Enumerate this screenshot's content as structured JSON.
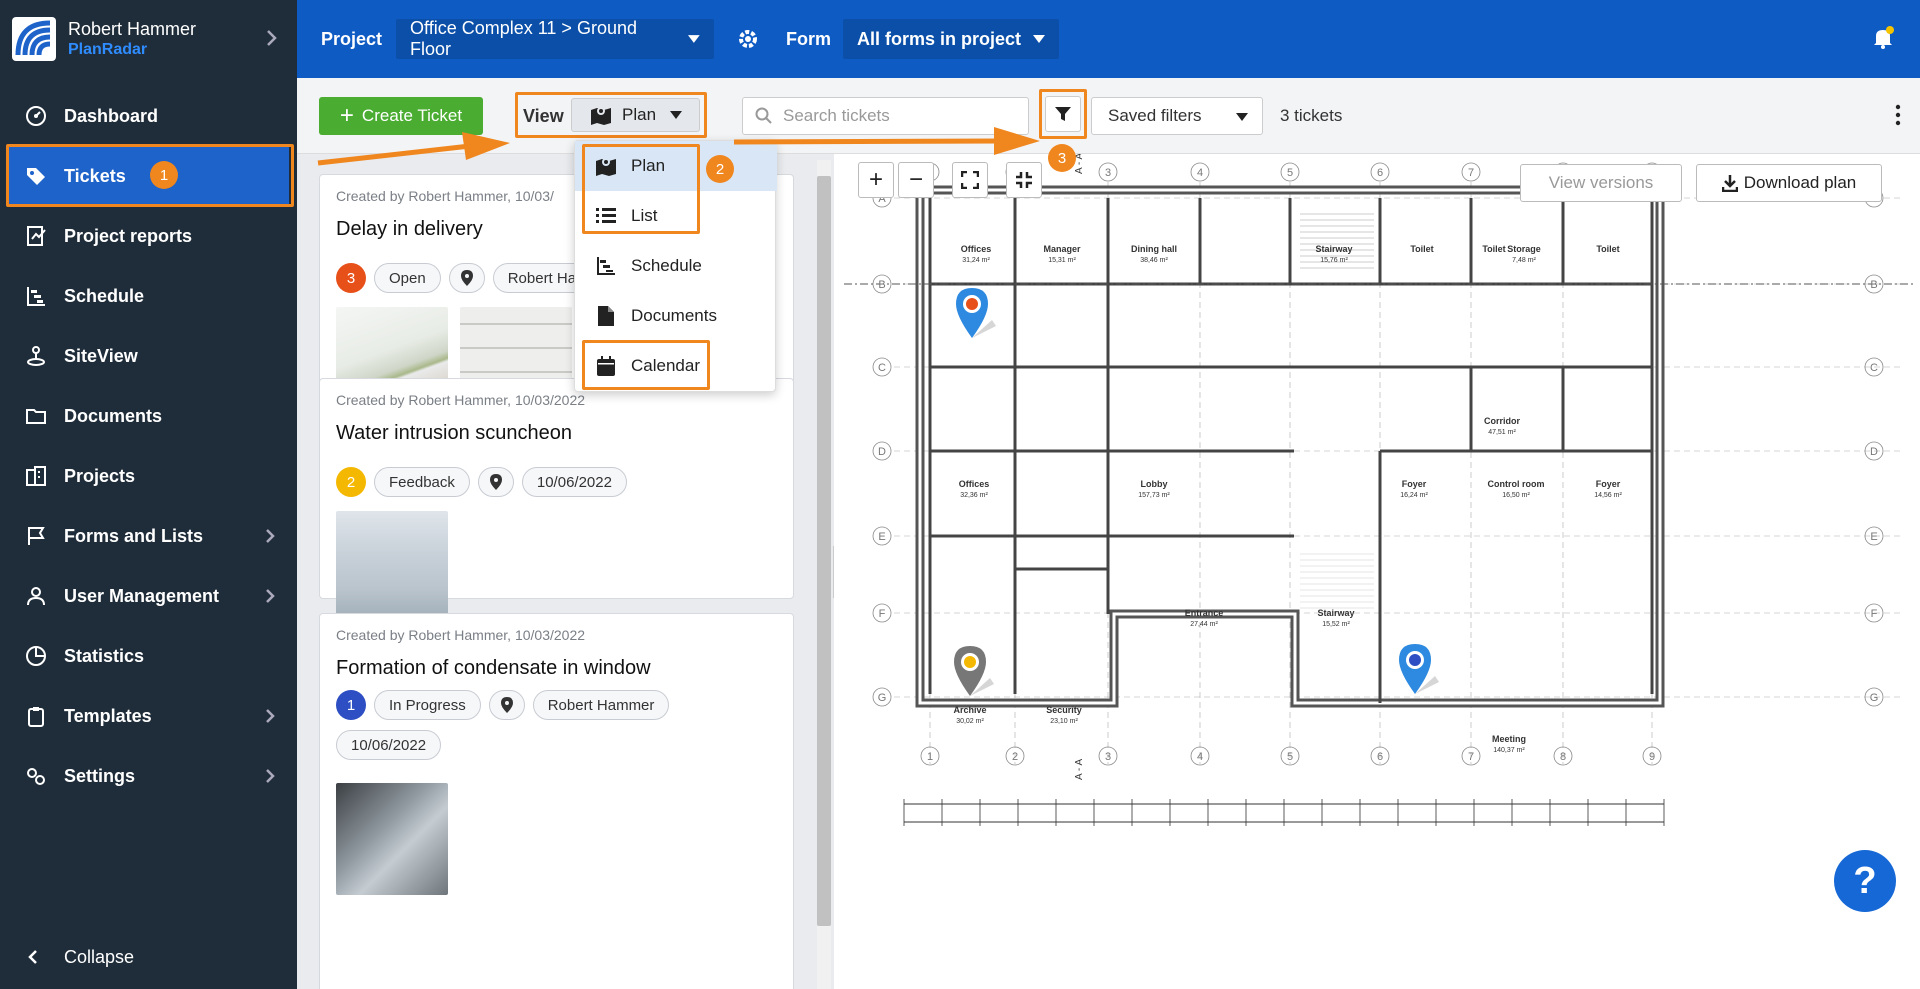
{
  "sidebar": {
    "user_name": "Robert Hammer",
    "brand": "PlanRadar",
    "items": [
      {
        "label": "Dashboard",
        "icon": "dashboard-icon"
      },
      {
        "label": "Tickets",
        "icon": "tag-icon"
      },
      {
        "label": "Project reports",
        "icon": "report-icon"
      },
      {
        "label": "Schedule",
        "icon": "schedule-icon"
      },
      {
        "label": "SiteView",
        "icon": "siteview-icon"
      },
      {
        "label": "Documents",
        "icon": "folder-icon"
      },
      {
        "label": "Projects",
        "icon": "building-icon"
      },
      {
        "label": "Forms and Lists",
        "icon": "flag-icon"
      },
      {
        "label": "User Management",
        "icon": "user-icon"
      },
      {
        "label": "Statistics",
        "icon": "pie-chart-icon"
      },
      {
        "label": "Templates",
        "icon": "clipboard-icon"
      },
      {
        "label": "Settings",
        "icon": "gears-icon"
      }
    ],
    "collapse_label": "Collapse",
    "active_badge": "1"
  },
  "topbar": {
    "project_label": "Project",
    "project_value": "Office Complex 11 > Ground Floor",
    "form_label": "Form",
    "form_value": "All forms in project"
  },
  "toolbar": {
    "create_label": "Create Ticket",
    "view_label": "View",
    "view_value": "Plan",
    "search_placeholder": "Search tickets",
    "saved_filters": "Saved filters",
    "ticket_count": "3 tickets",
    "filter_badge": "3"
  },
  "view_menu": {
    "items": [
      "Plan",
      "List",
      "Schedule",
      "Documents",
      "Calendar"
    ],
    "badge": "2"
  },
  "tickets": [
    {
      "meta": "Created by Robert Hammer, 10/03/",
      "title": "Delay in delivery",
      "priority": "3",
      "priority_color": "#e8501a",
      "status": "Open",
      "assignee": "Robert Ha"
    },
    {
      "meta": "Created by Robert Hammer, 10/03/2022",
      "title": "Water intrusion scuncheon",
      "priority": "2",
      "priority_color": "#f5b800",
      "status": "Feedback",
      "date": "10/06/2022"
    },
    {
      "meta": "Created by Robert Hammer, 10/03/2022",
      "title": "Formation of condensate in window",
      "priority": "1",
      "priority_color": "#2e4fc4",
      "status": "In Progress",
      "assignee": "Robert Hammer",
      "date": "10/06/2022"
    }
  ],
  "plan": {
    "view_versions": "View versions",
    "download": "Download plan",
    "help": "?",
    "rooms": [
      {
        "name": "Offices",
        "area": "31,24 m²"
      },
      {
        "name": "Manager",
        "area": "15,31 m²"
      },
      {
        "name": "Dining hall",
        "area": "38,46 m²"
      },
      {
        "name": "Stairway",
        "area": "15,76 m²"
      },
      {
        "name": "Toilet",
        "area": ""
      },
      {
        "name": "Toilet",
        "area": ""
      },
      {
        "name": "Storage",
        "area": "7,48 m²"
      },
      {
        "name": "Toilet",
        "area": ""
      },
      {
        "name": "Corridor",
        "area": "47,51 m²"
      },
      {
        "name": "Offices",
        "area": "32,36 m²"
      },
      {
        "name": "Lobby",
        "area": "157,73 m²"
      },
      {
        "name": "Foyer",
        "area": "16,24 m²"
      },
      {
        "name": "Control room",
        "area": "16,50 m²"
      },
      {
        "name": "Foyer",
        "area": "14,56 m²"
      },
      {
        "name": "Entrance",
        "area": "27,44 m²"
      },
      {
        "name": "Stairway",
        "area": "15,52 m²"
      },
      {
        "name": "Archive",
        "area": "30,02 m²"
      },
      {
        "name": "Security",
        "area": "23,10 m²"
      },
      {
        "name": "Meeting",
        "area": "140,37 m²"
      }
    ],
    "grid_cols": [
      "1",
      "2",
      "3",
      "4",
      "5",
      "6",
      "7",
      "8",
      "9"
    ],
    "grid_rows": [
      "A",
      "B",
      "C",
      "D",
      "E",
      "F",
      "G"
    ],
    "section_label": "A - A"
  },
  "colors": {
    "sidebar": "#1f2d3a",
    "topbar": "#0f5bc4",
    "active": "#1e63c9",
    "create": "#4aac30",
    "highlight": "#f0861e",
    "pin_red": "#e8501a",
    "pin_yellow": "#f5b800",
    "pin_blue": "#2e4fc4"
  }
}
